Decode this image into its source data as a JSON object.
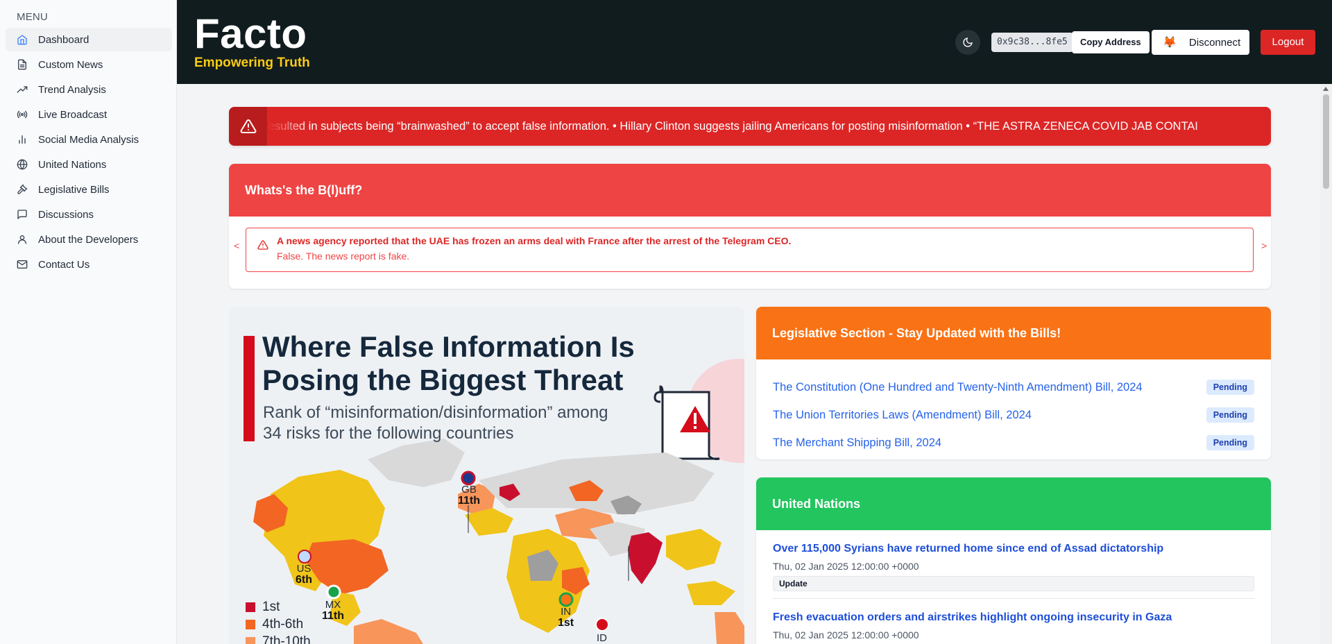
{
  "sidebar": {
    "menu_label": "MENU",
    "items": [
      {
        "label": "Dashboard",
        "icon": "home-icon"
      },
      {
        "label": "Custom News",
        "icon": "document-icon"
      },
      {
        "label": "Trend Analysis",
        "icon": "trend-icon"
      },
      {
        "label": "Live Broadcast",
        "icon": "broadcast-icon"
      },
      {
        "label": "Social Media Analysis",
        "icon": "bar-chart-icon"
      },
      {
        "label": "United Nations",
        "icon": "globe-icon"
      },
      {
        "label": "Legislative Bills",
        "icon": "gavel-icon"
      },
      {
        "label": "Discussions",
        "icon": "chat-icon"
      },
      {
        "label": "About the Developers",
        "icon": "user-icon"
      },
      {
        "label": "Contact Us",
        "icon": "mail-icon"
      }
    ]
  },
  "header": {
    "brand": "Facto",
    "tagline": "Empowering Truth",
    "wallet_address": "0x9c38...8fe5",
    "copy_label": "Copy Address",
    "disconnect_label": "Disconnect",
    "logout_label": "Logout"
  },
  "ticker": {
    "text": "ages resulted in subjects being “brainwashed” to accept false information. • Hillary Clinton suggests jailing Americans for posting misinformation • “THE ASTRA ZENECA COVID JAB CONTAI"
  },
  "bluff": {
    "title": "Whats's the B(l)uff?",
    "prev": "<",
    "next": ">",
    "claim": "A news agency reported that the UAE has frozen an arms deal with France after the arrest of the Telegram CEO.",
    "verdict": "False. The news report is fake."
  },
  "infographic": {
    "title_line1": "Where False Information Is",
    "title_line2": "Posing the Biggest Threat",
    "subtitle_line1": "Rank of “misinformation/disinformation” among",
    "subtitle_line2": "34 risks for the following countries",
    "countries": [
      {
        "code": "GB",
        "rank": "11th"
      },
      {
        "code": "US",
        "rank": "6th"
      },
      {
        "code": "MX",
        "rank": "11th"
      },
      {
        "code": "IN",
        "rank": "1st"
      },
      {
        "code": "ID",
        "rank": ""
      }
    ],
    "legend": [
      {
        "label": "1st",
        "color": "#c8102e"
      },
      {
        "label": "4th-6th",
        "color": "#f26522"
      },
      {
        "label": "7th-10th",
        "color": "#f7955b"
      }
    ]
  },
  "legislative": {
    "title": "Legislative Section - Stay Updated with the Bills!",
    "bills": [
      {
        "name": "The Constitution (One Hundred and Twenty-Ninth Amendment) Bill, 2024",
        "status": "Pending"
      },
      {
        "name": "The Union Territories Laws (Amendment) Bill, 2024",
        "status": "Pending"
      },
      {
        "name": "The Merchant Shipping Bill, 2024",
        "status": "Pending"
      }
    ]
  },
  "un": {
    "title": "United Nations",
    "items": [
      {
        "headline": "Over 115,000 Syrians have returned home since end of Assad dictatorship",
        "date": "Thu, 02 Jan 2025 12:00:00 +0000",
        "tag": "Update"
      },
      {
        "headline": "Fresh evacuation orders and airstrikes highlight ongoing insecurity in Gaza",
        "date": "Thu, 02 Jan 2025 12:00:00 +0000",
        "tag": ""
      }
    ]
  },
  "colors": {
    "header_bg": "#111c1f",
    "tagline": "#facc15",
    "ticker": "#dc2626",
    "bluff": "#ef4444",
    "legislative": "#f97316",
    "un": "#22c55e",
    "logout": "#dc2626"
  }
}
